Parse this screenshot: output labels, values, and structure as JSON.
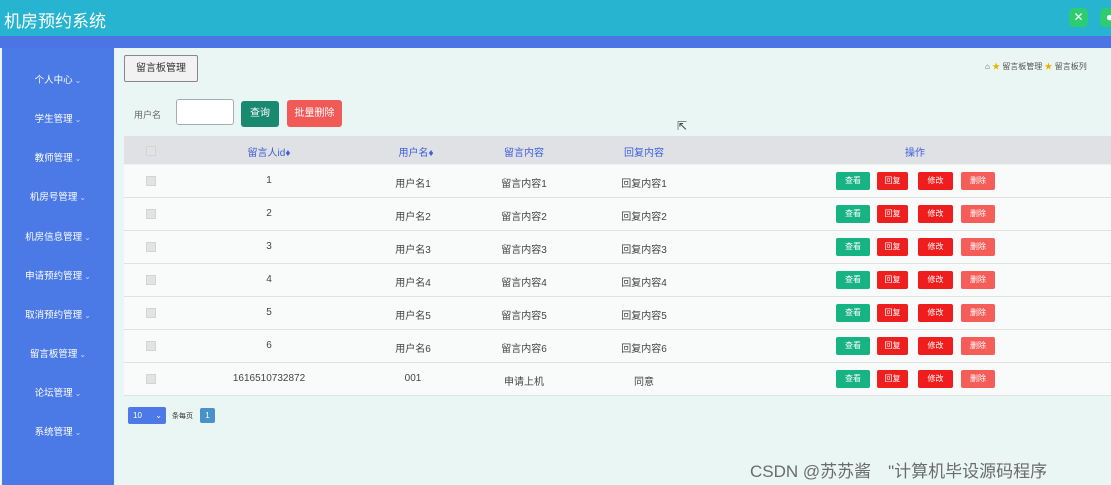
{
  "app": {
    "title": "机房预约系统"
  },
  "topbar": {
    "icons": [
      "fullscreen-icon",
      "user-icon"
    ]
  },
  "sidebar": {
    "items": [
      {
        "label": "个人中心"
      },
      {
        "label": "学生管理"
      },
      {
        "label": "教师管理"
      },
      {
        "label": "机房号管理"
      },
      {
        "label": "机房信息管理"
      },
      {
        "label": "申请预约管理"
      },
      {
        "label": "取消预约管理"
      },
      {
        "label": "留言板管理"
      },
      {
        "label": "论坛管理"
      },
      {
        "label": "系统管理"
      }
    ]
  },
  "page": {
    "tab": "留言板管理",
    "breadcrumb": {
      "home_icon": "home-icon",
      "item1": "留言板管理",
      "item2": "留言板列"
    }
  },
  "search": {
    "label": "用户名",
    "value": "",
    "search_button": "查询",
    "batch_delete_button": "批量删除"
  },
  "table": {
    "headers": {
      "id": "留言人id♦",
      "username": "用户名♦",
      "content": "留言内容",
      "reply": "回复内容",
      "actions": "操作"
    },
    "buttons": {
      "view": "查看",
      "reply": "回复",
      "edit": "修改",
      "delete": "删除"
    },
    "rows": [
      {
        "id": "1",
        "username": "用户名1",
        "content": "留言内容1",
        "reply": "回复内容1"
      },
      {
        "id": "2",
        "username": "用户名2",
        "content": "留言内容2",
        "reply": "回复内容2"
      },
      {
        "id": "3",
        "username": "用户名3",
        "content": "留言内容3",
        "reply": "回复内容3"
      },
      {
        "id": "4",
        "username": "用户名4",
        "content": "留言内容4",
        "reply": "回复内容4"
      },
      {
        "id": "5",
        "username": "用户名5",
        "content": "留言内容5",
        "reply": "回复内容5"
      },
      {
        "id": "6",
        "username": "用户名6",
        "content": "留言内容6",
        "reply": "回复内容6"
      },
      {
        "id": "1616510732872",
        "username": "001",
        "content": "申请上机",
        "reply": "同意"
      }
    ]
  },
  "pagination": {
    "page_size": "10",
    "per_page_label": "条每页",
    "current_page": "1"
  },
  "watermark": "CSDN @苏苏酱　\"计算机毕设源码程序",
  "colors": {
    "topbar": "#27b4d0",
    "sidebar": "#4b7ae7",
    "view": "#17b382",
    "reply": "#ee1f1f",
    "edit": "#ef1d1d",
    "delete": "#f55d59"
  }
}
